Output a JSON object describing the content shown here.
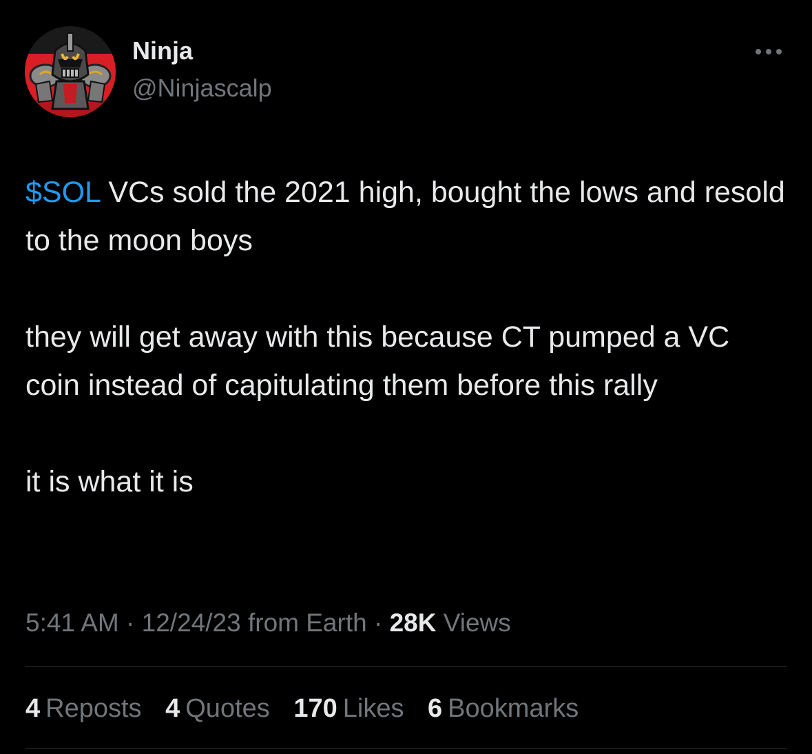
{
  "author": {
    "name": "Ninja",
    "handle": "@Ninjascalp",
    "avatar_icon": "ninja-knight-avatar"
  },
  "more_icon": "more-dots-icon",
  "tweet": {
    "cashtag": "$SOL",
    "line1_rest": " VCs sold the 2021 high, bought the lows and resold to the moon boys",
    "paragraph2": "they will get away with this because CT pumped a VC coin instead of capitulating them before this rally",
    "paragraph3": "it is what it is"
  },
  "meta": {
    "time": "5:41 AM",
    "separator": " · ",
    "date": "12/24/23",
    "source": " from Earth",
    "separator2": " · ",
    "views_count": "28K",
    "views_label": " Views"
  },
  "stats": [
    {
      "count": "4",
      "label": "Reposts"
    },
    {
      "count": "4",
      "label": "Quotes"
    },
    {
      "count": "170",
      "label": "Likes"
    },
    {
      "count": "6",
      "label": "Bookmarks"
    }
  ],
  "colors": {
    "background": "#000000",
    "text_primary": "#e7e9ea",
    "text_secondary": "#71767b",
    "link": "#1d9bf0",
    "divider": "#2f3336",
    "avatar_red": "#d81f26"
  }
}
